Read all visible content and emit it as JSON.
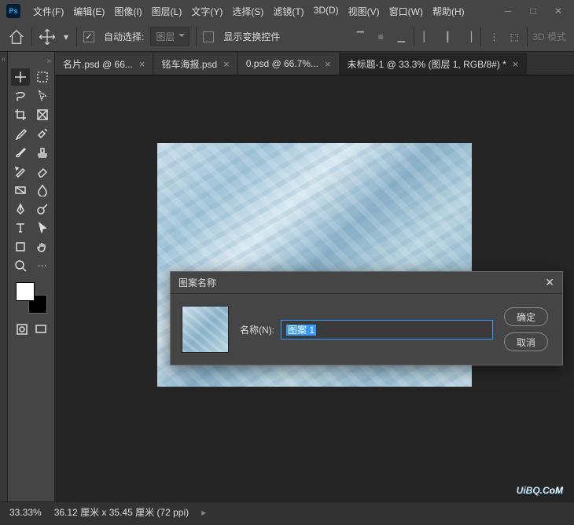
{
  "menus": [
    "文件(F)",
    "编辑(E)",
    "图像(I)",
    "图层(L)",
    "文字(Y)",
    "选择(S)",
    "滤镜(T)",
    "3D(D)",
    "视图(V)",
    "窗口(W)",
    "帮助(H)"
  ],
  "options": {
    "auto_select_label": "自动选择:",
    "auto_select_value": "图层",
    "show_transform_label": "显示变换控件",
    "threeD_mode": "3D 模式"
  },
  "tabs": [
    {
      "label": "名片.psd @ 66...",
      "active": false
    },
    {
      "label": "铭车海报.psd",
      "active": false
    },
    {
      "label": "0.psd @ 66.7%...",
      "active": false
    },
    {
      "label": "未标题-1 @ 33.3% (图层 1, RGB/8#) *",
      "active": true
    }
  ],
  "dialog": {
    "title": "图案名称",
    "field_label": "名称(N):",
    "field_value": "图案 1",
    "ok": "确定",
    "cancel": "取消"
  },
  "status": {
    "zoom": "33.33%",
    "doc_info": "36.12 厘米 x 35.45 厘米 (72 ppi)"
  },
  "watermark": {
    "text": "UiBQ.C",
    "suffix": "oM"
  }
}
